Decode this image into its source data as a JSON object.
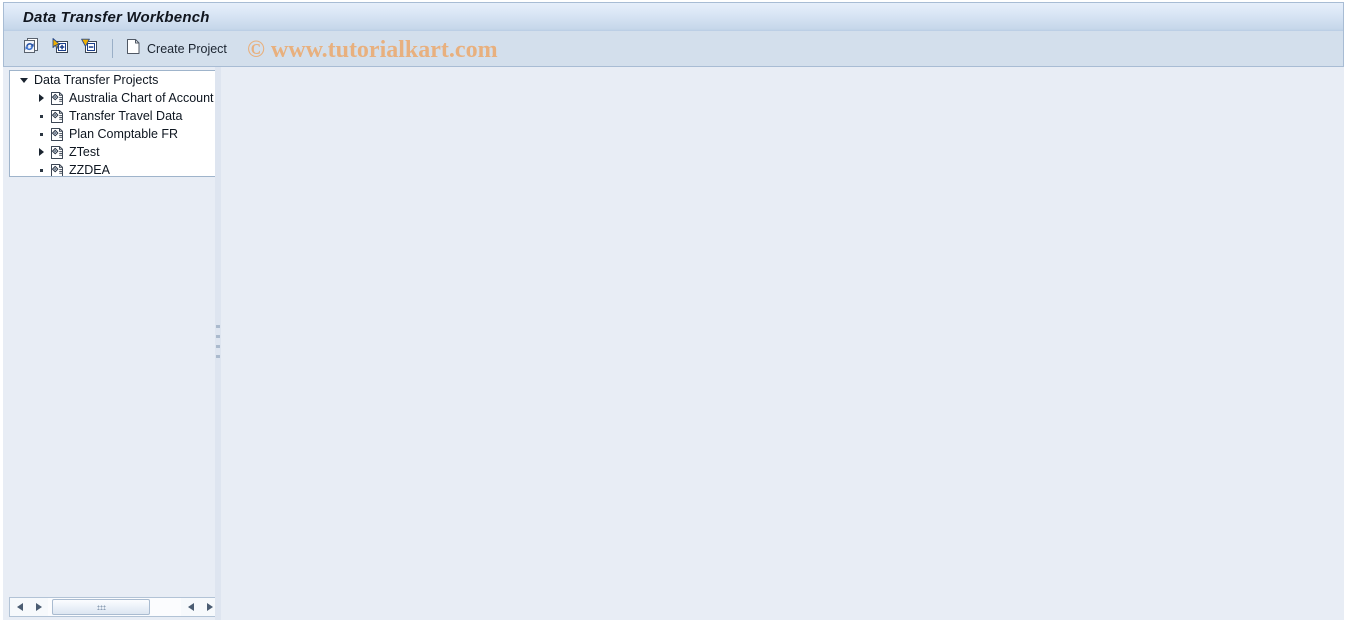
{
  "window": {
    "title": "Data Transfer Workbench"
  },
  "watermark": {
    "text": "© www.tutorialkart.com",
    "color": "#e8b07e"
  },
  "toolbar": {
    "buttons": [
      {
        "name": "refresh-icon",
        "tooltip": "Refresh"
      },
      {
        "name": "expand-all-icon",
        "tooltip": "Expand All"
      },
      {
        "name": "collapse-all-icon",
        "tooltip": "Collapse All"
      }
    ],
    "create_project_label": "Create Project",
    "create_project_icon": "document-icon"
  },
  "tree": {
    "root": {
      "label": "Data Transfer Projects",
      "expanded": true
    },
    "items": [
      {
        "label": "Australia Chart of Account",
        "expandable": true,
        "icon": "project-icon"
      },
      {
        "label": "Transfer Travel Data",
        "expandable": false,
        "icon": "project-icon"
      },
      {
        "label": "Plan Comptable FR",
        "expandable": false,
        "icon": "project-icon"
      },
      {
        "label": "ZTest",
        "expandable": true,
        "icon": "project-icon"
      },
      {
        "label": "ZZDEA",
        "expandable": false,
        "icon": "project-icon"
      }
    ]
  },
  "scrollbar": {
    "left_arrow": "triangle-left-icon",
    "right_arrow": "triangle-right-icon",
    "thumb": "scroll-thumb"
  },
  "colors": {
    "titlebar_top": "#e6eefa",
    "titlebar_bottom": "#b9cde4",
    "toolbar_bg": "#d3dfec",
    "content_bg": "#e8edf5",
    "tree_bg": "#ffffff",
    "border": "#9fb4cb",
    "text": "#0e1620"
  }
}
